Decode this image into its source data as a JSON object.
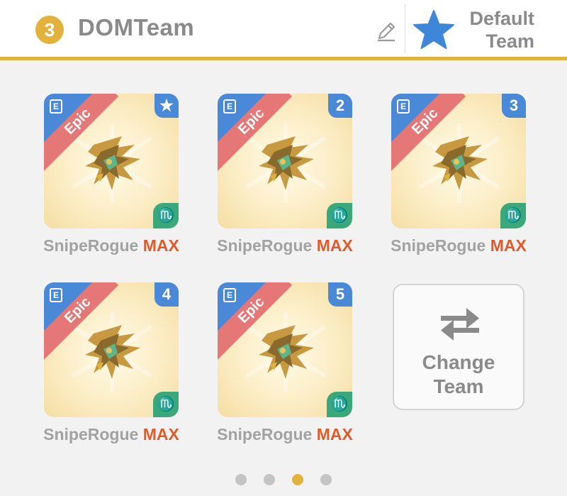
{
  "header": {
    "team_number": "3",
    "team_name": "DOMTeam",
    "default_label": "Default Team",
    "accent_color": "#e2b23c"
  },
  "cards": [
    {
      "rarity": "Epic",
      "slot": "★",
      "name": "SnipeRogue",
      "level": "MAX",
      "class_icon": "E",
      "element_icon": "scorpio-icon"
    },
    {
      "rarity": "Epic",
      "slot": "2",
      "name": "SnipeRogue",
      "level": "MAX",
      "class_icon": "E",
      "element_icon": "scorpio-icon"
    },
    {
      "rarity": "Epic",
      "slot": "3",
      "name": "SnipeRogue",
      "level": "MAX",
      "class_icon": "E",
      "element_icon": "scorpio-icon"
    },
    {
      "rarity": "Epic",
      "slot": "4",
      "name": "SnipeRogue",
      "level": "MAX",
      "class_icon": "E",
      "element_icon": "scorpio-icon"
    },
    {
      "rarity": "Epic",
      "slot": "5",
      "name": "SnipeRogue",
      "level": "MAX",
      "class_icon": "E",
      "element_icon": "scorpio-icon"
    }
  ],
  "change_team": {
    "label_line1": "Change",
    "label_line2": "Team"
  },
  "pagination": {
    "total": 4,
    "active_index": 2
  }
}
